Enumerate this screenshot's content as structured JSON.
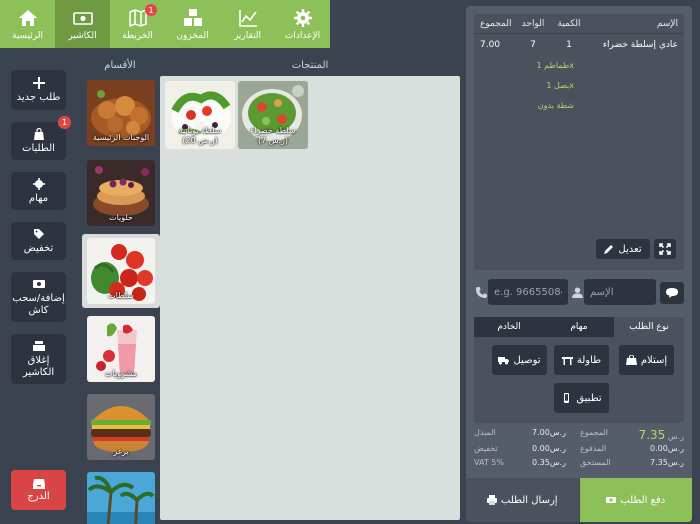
{
  "nav": {
    "items": [
      {
        "label": "الرئيسية",
        "icon": "home-icon"
      },
      {
        "label": "الكاشير",
        "icon": "cash-icon",
        "active": true
      },
      {
        "label": "الخريطة",
        "icon": "map-icon",
        "badge": "1"
      },
      {
        "label": "المخزون",
        "icon": "boxes-icon"
      },
      {
        "label": "التقارير",
        "icon": "chart-icon"
      },
      {
        "label": "الإعدادات",
        "icon": "gear-icon"
      }
    ]
  },
  "sidebar": {
    "new_order": "طلب جديد",
    "orders": "الطلبات",
    "orders_badge": "1",
    "tasks": "مهام",
    "discount": "تخفيض",
    "cash_in_out": "إضافة/سحب كاش",
    "close_cashier": "إغلاق الكاشير",
    "drawer": "الدرج"
  },
  "categories": {
    "header": "الأقسام",
    "items": [
      {
        "label": "الوجبات الرئيسية"
      },
      {
        "label": "حلويات"
      },
      {
        "label": "سلطات",
        "active": true
      },
      {
        "label": "مشروبات"
      },
      {
        "label": "برغر"
      },
      {
        "label": ""
      }
    ]
  },
  "products": {
    "header": "المنتجات",
    "items": [
      {
        "label": "سلطة خضراء",
        "price": "(ر.س 7)"
      },
      {
        "label": "سلطة يونانية",
        "price": "(ر.س 20)"
      }
    ]
  },
  "order": {
    "headers": {
      "total": "المجموع",
      "unit": "الواحد",
      "qty": "الكمية",
      "name": "الإسم"
    },
    "rows": [
      {
        "total": "7.00",
        "unit": "7",
        "qty": "1",
        "name": "عادي إسلطة خضراء"
      }
    ],
    "modifiers": [
      "طماطم 1x",
      "بصل 1x",
      "شطة بدون"
    ],
    "edit_label": "تعديل",
    "phone_placeholder": "e.g. 966550840",
    "name_placeholder": "الإسم",
    "tabs": [
      "الخادم",
      "مهام",
      "نوع الطلب"
    ],
    "order_types": {
      "pickup": "إستلام",
      "table": "طاولة",
      "delivery": "توصيل",
      "app": "تطبيق"
    }
  },
  "totals": {
    "grand_total": "7.35",
    "grand_currency": "ر.س",
    "total_label": "المجموع",
    "total_value": "ر.س7.00",
    "change_label": "المبدل",
    "paid_label": "المدفوع",
    "paid_value": "ر.س0.00",
    "discount_label": "تخفيض",
    "discount_value": "ر.س0.00",
    "due_label": "المستحق",
    "due_value": "ر.س7.35",
    "vat_label": "VAT 5%",
    "vat_value": "ر.س0.35"
  },
  "actions": {
    "pay": "دفع الطلب",
    "send": "إرسال الطلب"
  },
  "colors": {
    "accent": "#8dc058",
    "background": "#3c4350",
    "panel": "#565d6a",
    "danger": "#d94545"
  }
}
